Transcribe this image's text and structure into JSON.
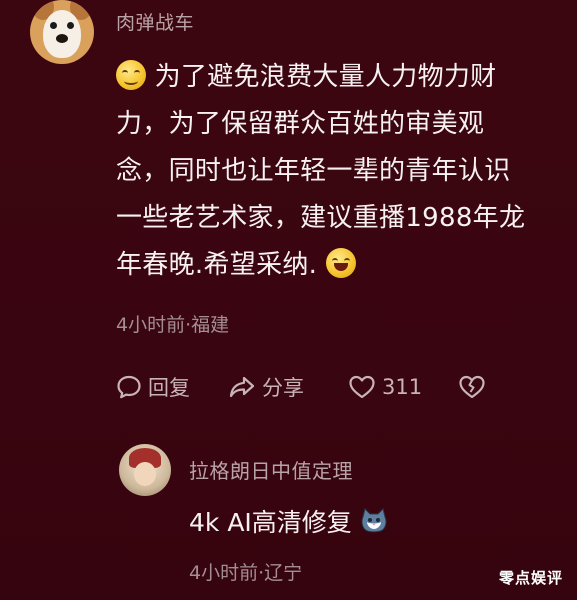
{
  "main_comment": {
    "username": "肉弹战车",
    "text_line1": "为了避免浪费大量人力物力财",
    "text_line2": "力，为了保留群众百姓的审美观",
    "text_line3": "念，同时也让年轻一辈的青年认识",
    "text_line4": "一些老艺术家，建议重播1988年龙",
    "text_line5": "年春晚.希望采纳.",
    "meta": "4小时前·福建",
    "leading_emoji": "smiling-face-emoji",
    "trailing_emoji": "laughing-face-emoji"
  },
  "actions": {
    "reply_label": "回复",
    "share_label": "分享",
    "like_count": "311"
  },
  "reply": {
    "username": "拉格朗日中值定理",
    "text": "4k AI高清修复",
    "emoji": "cat-face-emoji",
    "meta": "4小时前·辽宁"
  },
  "watermark": "零点娱评",
  "colors": {
    "background": "#3a050f",
    "primary_text": "#f7f1f2",
    "secondary_text": "#a38e92"
  }
}
